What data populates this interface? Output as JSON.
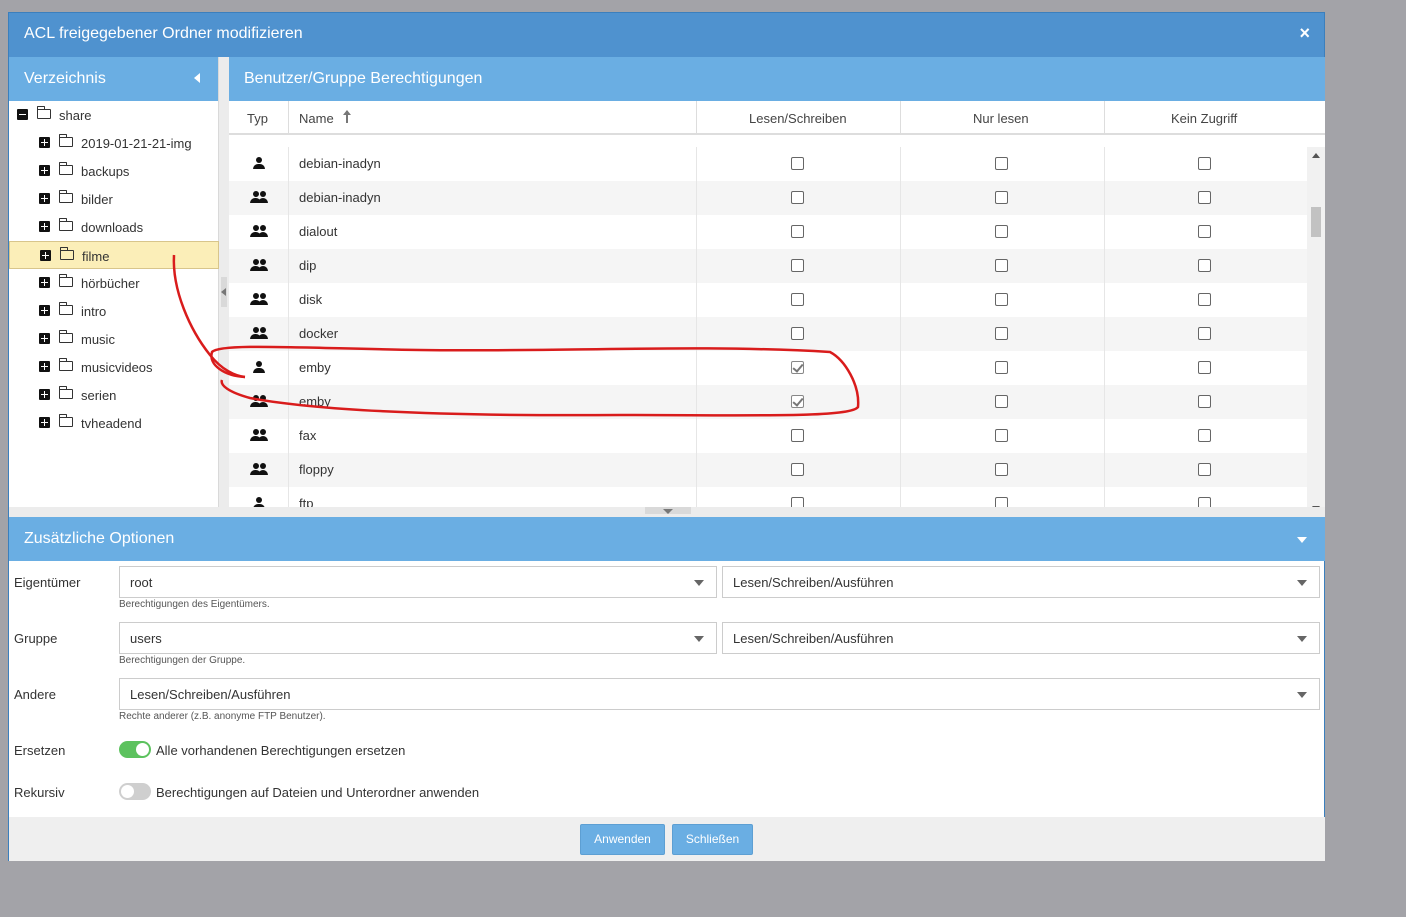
{
  "dialog": {
    "title": "ACL freigegebener Ordner modifizieren",
    "close_icon": "×"
  },
  "left_panel": {
    "header": "Verzeichnis",
    "tree": [
      {
        "label": "share",
        "level": 0,
        "expanded": true
      },
      {
        "label": "2019-01-21-21-img",
        "level": 1
      },
      {
        "label": "backups",
        "level": 1
      },
      {
        "label": "bilder",
        "level": 1
      },
      {
        "label": "downloads",
        "level": 1
      },
      {
        "label": "filme",
        "level": 1,
        "selected": true
      },
      {
        "label": "hörbücher",
        "level": 1
      },
      {
        "label": "intro",
        "level": 1
      },
      {
        "label": "music",
        "level": 1
      },
      {
        "label": "musicvideos",
        "level": 1
      },
      {
        "label": "serien",
        "level": 1
      },
      {
        "label": "tvheadend",
        "level": 1
      }
    ]
  },
  "right_panel": {
    "header": "Benutzer/Gruppe Berechtigungen",
    "columns": {
      "type": "Typ",
      "name": "Name",
      "rw": "Lesen/Schreiben",
      "ro": "Nur lesen",
      "none": "Kein Zugriff"
    },
    "rows": [
      {
        "type": "user",
        "name": "debian-inadyn",
        "rw": false,
        "ro": false,
        "none": false
      },
      {
        "type": "group",
        "name": "debian-inadyn",
        "rw": false,
        "ro": false,
        "none": false
      },
      {
        "type": "group",
        "name": "dialout",
        "rw": false,
        "ro": false,
        "none": false
      },
      {
        "type": "group",
        "name": "dip",
        "rw": false,
        "ro": false,
        "none": false
      },
      {
        "type": "group",
        "name": "disk",
        "rw": false,
        "ro": false,
        "none": false
      },
      {
        "type": "group",
        "name": "docker",
        "rw": false,
        "ro": false,
        "none": false
      },
      {
        "type": "user",
        "name": "emby",
        "rw": true,
        "ro": false,
        "none": false
      },
      {
        "type": "group",
        "name": "emby",
        "rw": true,
        "ro": false,
        "none": false
      },
      {
        "type": "group",
        "name": "fax",
        "rw": false,
        "ro": false,
        "none": false
      },
      {
        "type": "group",
        "name": "floppy",
        "rw": false,
        "ro": false,
        "none": false
      },
      {
        "type": "user",
        "name": "ftp",
        "rw": false,
        "ro": false,
        "none": false
      }
    ]
  },
  "options": {
    "header": "Zusätzliche Optionen",
    "owner": {
      "label": "Eigentümer",
      "value": "root",
      "perm": "Lesen/Schreiben/Ausführen",
      "hint": "Berechtigungen des Eigentümers."
    },
    "group": {
      "label": "Gruppe",
      "value": "users",
      "perm": "Lesen/Schreiben/Ausführen",
      "hint": "Berechtigungen der Gruppe."
    },
    "others": {
      "label": "Andere",
      "perm": "Lesen/Schreiben/Ausführen",
      "hint": "Rechte anderer (z.B. anonyme FTP Benutzer)."
    },
    "replace": {
      "label": "Ersetzen",
      "on": true,
      "text": "Alle vorhandenen Berechtigungen ersetzen"
    },
    "recursive": {
      "label": "Rekursiv",
      "on": false,
      "text": "Berechtigungen auf Dateien und Unterordner anwenden"
    }
  },
  "footer": {
    "apply": "Anwenden",
    "close": "Schließen"
  },
  "colors": {
    "titlebar": "#4f92cf",
    "header": "#6aaee3",
    "selected": "#fbeeb8",
    "toggle_on": "#5cc25e",
    "annotation": "#d91c1c"
  }
}
